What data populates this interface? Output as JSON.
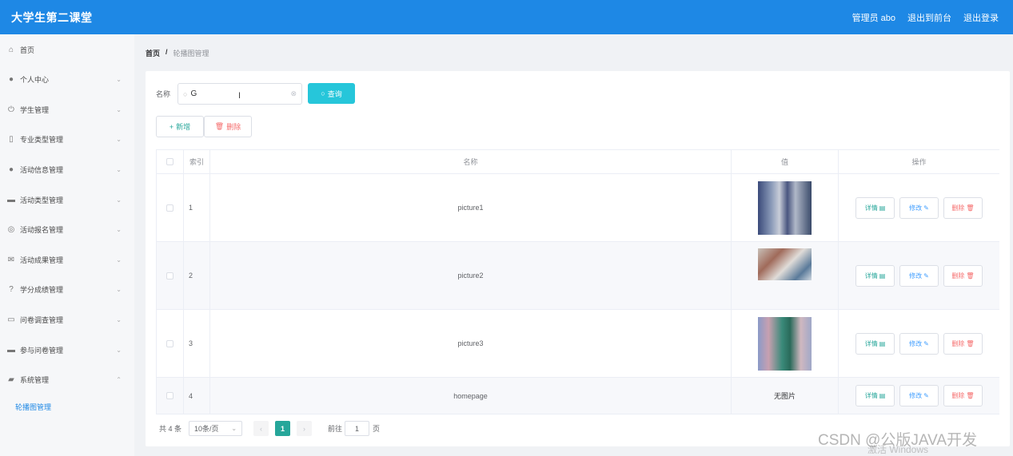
{
  "app": {
    "title": "大学生第二课堂"
  },
  "topbar": {
    "admin_label": "管理员 abo",
    "back_front": "退出到前台",
    "logout": "退出登录"
  },
  "sidebar": {
    "items": [
      {
        "label": "首页",
        "icon": "home-icon",
        "has_arrow": false
      },
      {
        "label": "个人中心",
        "icon": "user-icon",
        "has_arrow": true
      },
      {
        "label": "学生管理",
        "icon": "power-icon",
        "has_arrow": true
      },
      {
        "label": "专业类型管理",
        "icon": "phone-icon",
        "has_arrow": true
      },
      {
        "label": "活动信息管理",
        "icon": "location-icon",
        "has_arrow": true
      },
      {
        "label": "活动类型管理",
        "icon": "chat-icon",
        "has_arrow": true
      },
      {
        "label": "活动报名管理",
        "icon": "globe-icon",
        "has_arrow": true
      },
      {
        "label": "活动成果管理",
        "icon": "mail-icon",
        "has_arrow": true
      },
      {
        "label": "学分成绩管理",
        "icon": "help-icon",
        "has_arrow": true
      },
      {
        "label": "问卷调查管理",
        "icon": "message-icon",
        "has_arrow": true
      },
      {
        "label": "参与问卷管理",
        "icon": "folder-icon",
        "has_arrow": true
      },
      {
        "label": "系统管理",
        "icon": "system-icon",
        "has_arrow": true,
        "expanded": true
      }
    ],
    "sub_item": "轮播图管理"
  },
  "breadcrumb": {
    "home": "首页",
    "separator": "/",
    "current": "轮播图管理"
  },
  "search": {
    "label": "名称",
    "value": "G",
    "query_button": "查询"
  },
  "actions": {
    "add": "新增",
    "delete": "删除"
  },
  "table": {
    "headers": {
      "index": "索引",
      "name": "名称",
      "value": "值",
      "ops": "操作"
    },
    "rows": [
      {
        "index": "1",
        "name": "picture1",
        "value_image": true
      },
      {
        "index": "2",
        "name": "picture2",
        "value_image": true
      },
      {
        "index": "3",
        "name": "picture3",
        "value_image": true
      },
      {
        "index": "4",
        "name": "homepage",
        "value_text": "无图片"
      }
    ],
    "op_labels": {
      "detail": "详情",
      "edit": "修改",
      "delete": "删除"
    }
  },
  "pager": {
    "total": "共 4 条",
    "page_size": "10条/页",
    "current_page": "1",
    "goto_label": "前往",
    "goto_value": "1",
    "page_unit": "页"
  },
  "watermarks": {
    "csdn": "CSDN @公版JAVA开发",
    "windows": "激活 Windows"
  }
}
